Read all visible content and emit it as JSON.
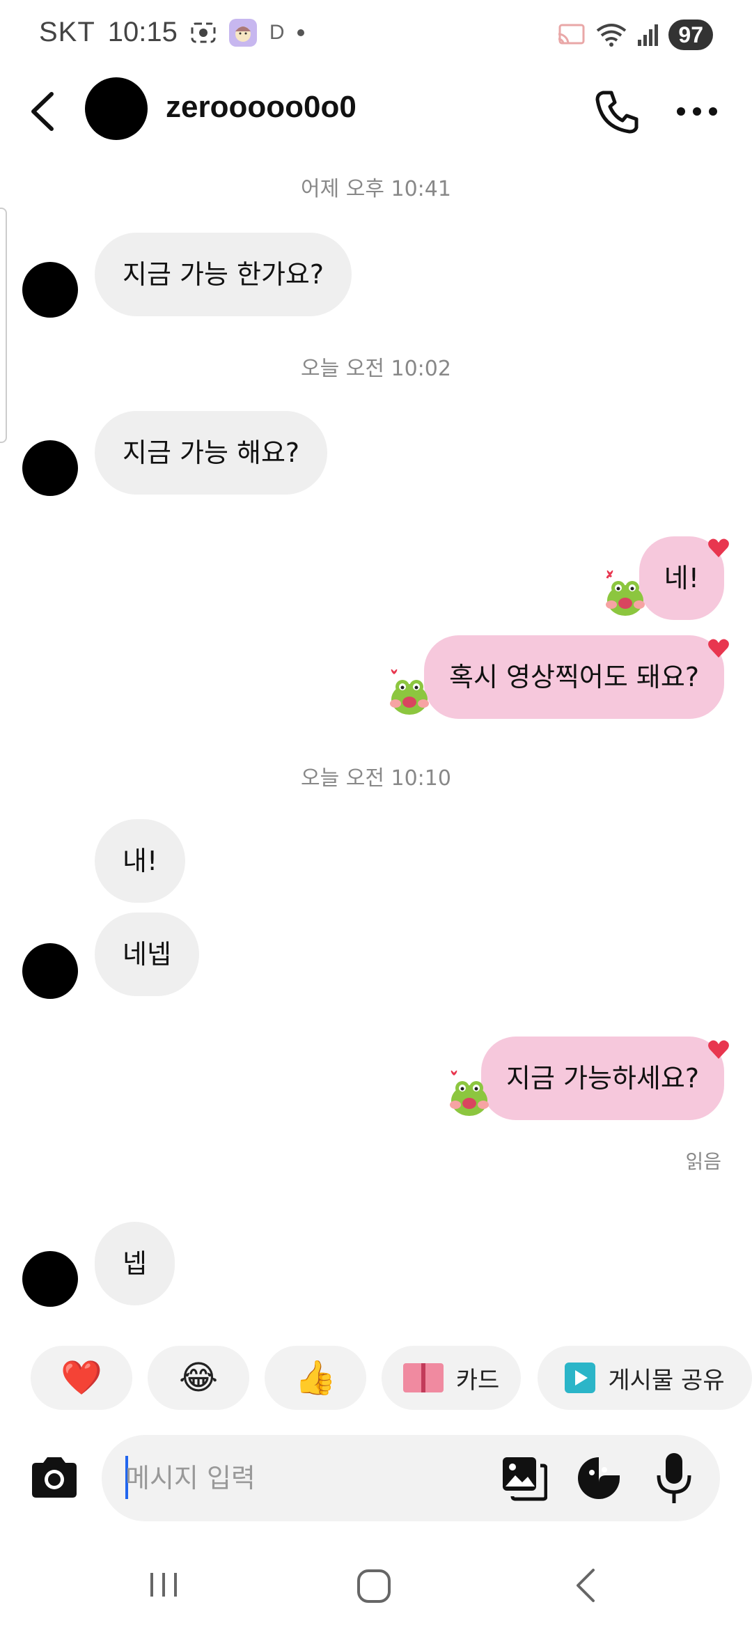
{
  "status_bar": {
    "carrier": "SKT",
    "time": "10:15",
    "indicator_letter": "D",
    "battery": "97"
  },
  "header": {
    "username": "zerooooo0o0"
  },
  "messages": {
    "ts1": "어제 오후 10:41",
    "in1": "지금 가능 한가요?",
    "ts2": "오늘 오전 10:02",
    "in2": "지금 가능 해요?",
    "out1": "네!",
    "out2": "혹시 영상찍어도 돼요?",
    "ts3": "오늘 오전 10:10",
    "in3": "내!",
    "in4": "네넵",
    "out3": "지금 가능하세요?",
    "read": "읽음",
    "in5": "넵"
  },
  "quick_replies": {
    "heart": "❤️",
    "laugh": "😂",
    "thumbs": "👍",
    "card": "카드",
    "share_post": "게시물 공유"
  },
  "composer": {
    "placeholder": "메시지 입력"
  },
  "colors": {
    "bubble_in": "#efefef",
    "bubble_out": "#f6c8dc",
    "reaction_heart": "#e8364f",
    "caret": "#2266ee"
  }
}
